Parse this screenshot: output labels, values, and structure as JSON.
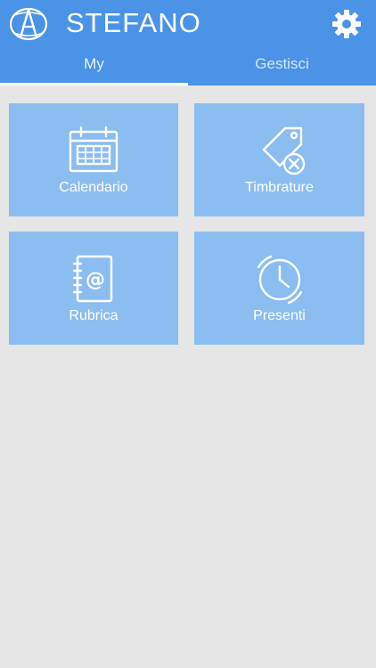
{
  "header": {
    "title": "STEFANO",
    "logo_icon": "globe-a-logo-icon",
    "settings_icon": "gear-icon"
  },
  "tabs": [
    {
      "label": "My",
      "active": true
    },
    {
      "label": "Gestisci",
      "active": false
    }
  ],
  "tiles": [
    {
      "label": "Calendario",
      "icon": "calendar-icon"
    },
    {
      "label": "Timbrature",
      "icon": "tag-cancel-icon"
    },
    {
      "label": "Rubrica",
      "icon": "address-book-icon"
    },
    {
      "label": "Presenti",
      "icon": "clock-icon"
    }
  ],
  "colors": {
    "header_bg": "#4a93e6",
    "tile_bg": "#8cbdf0",
    "page_bg": "#e6e6e6",
    "text_white": "#ffffff"
  }
}
